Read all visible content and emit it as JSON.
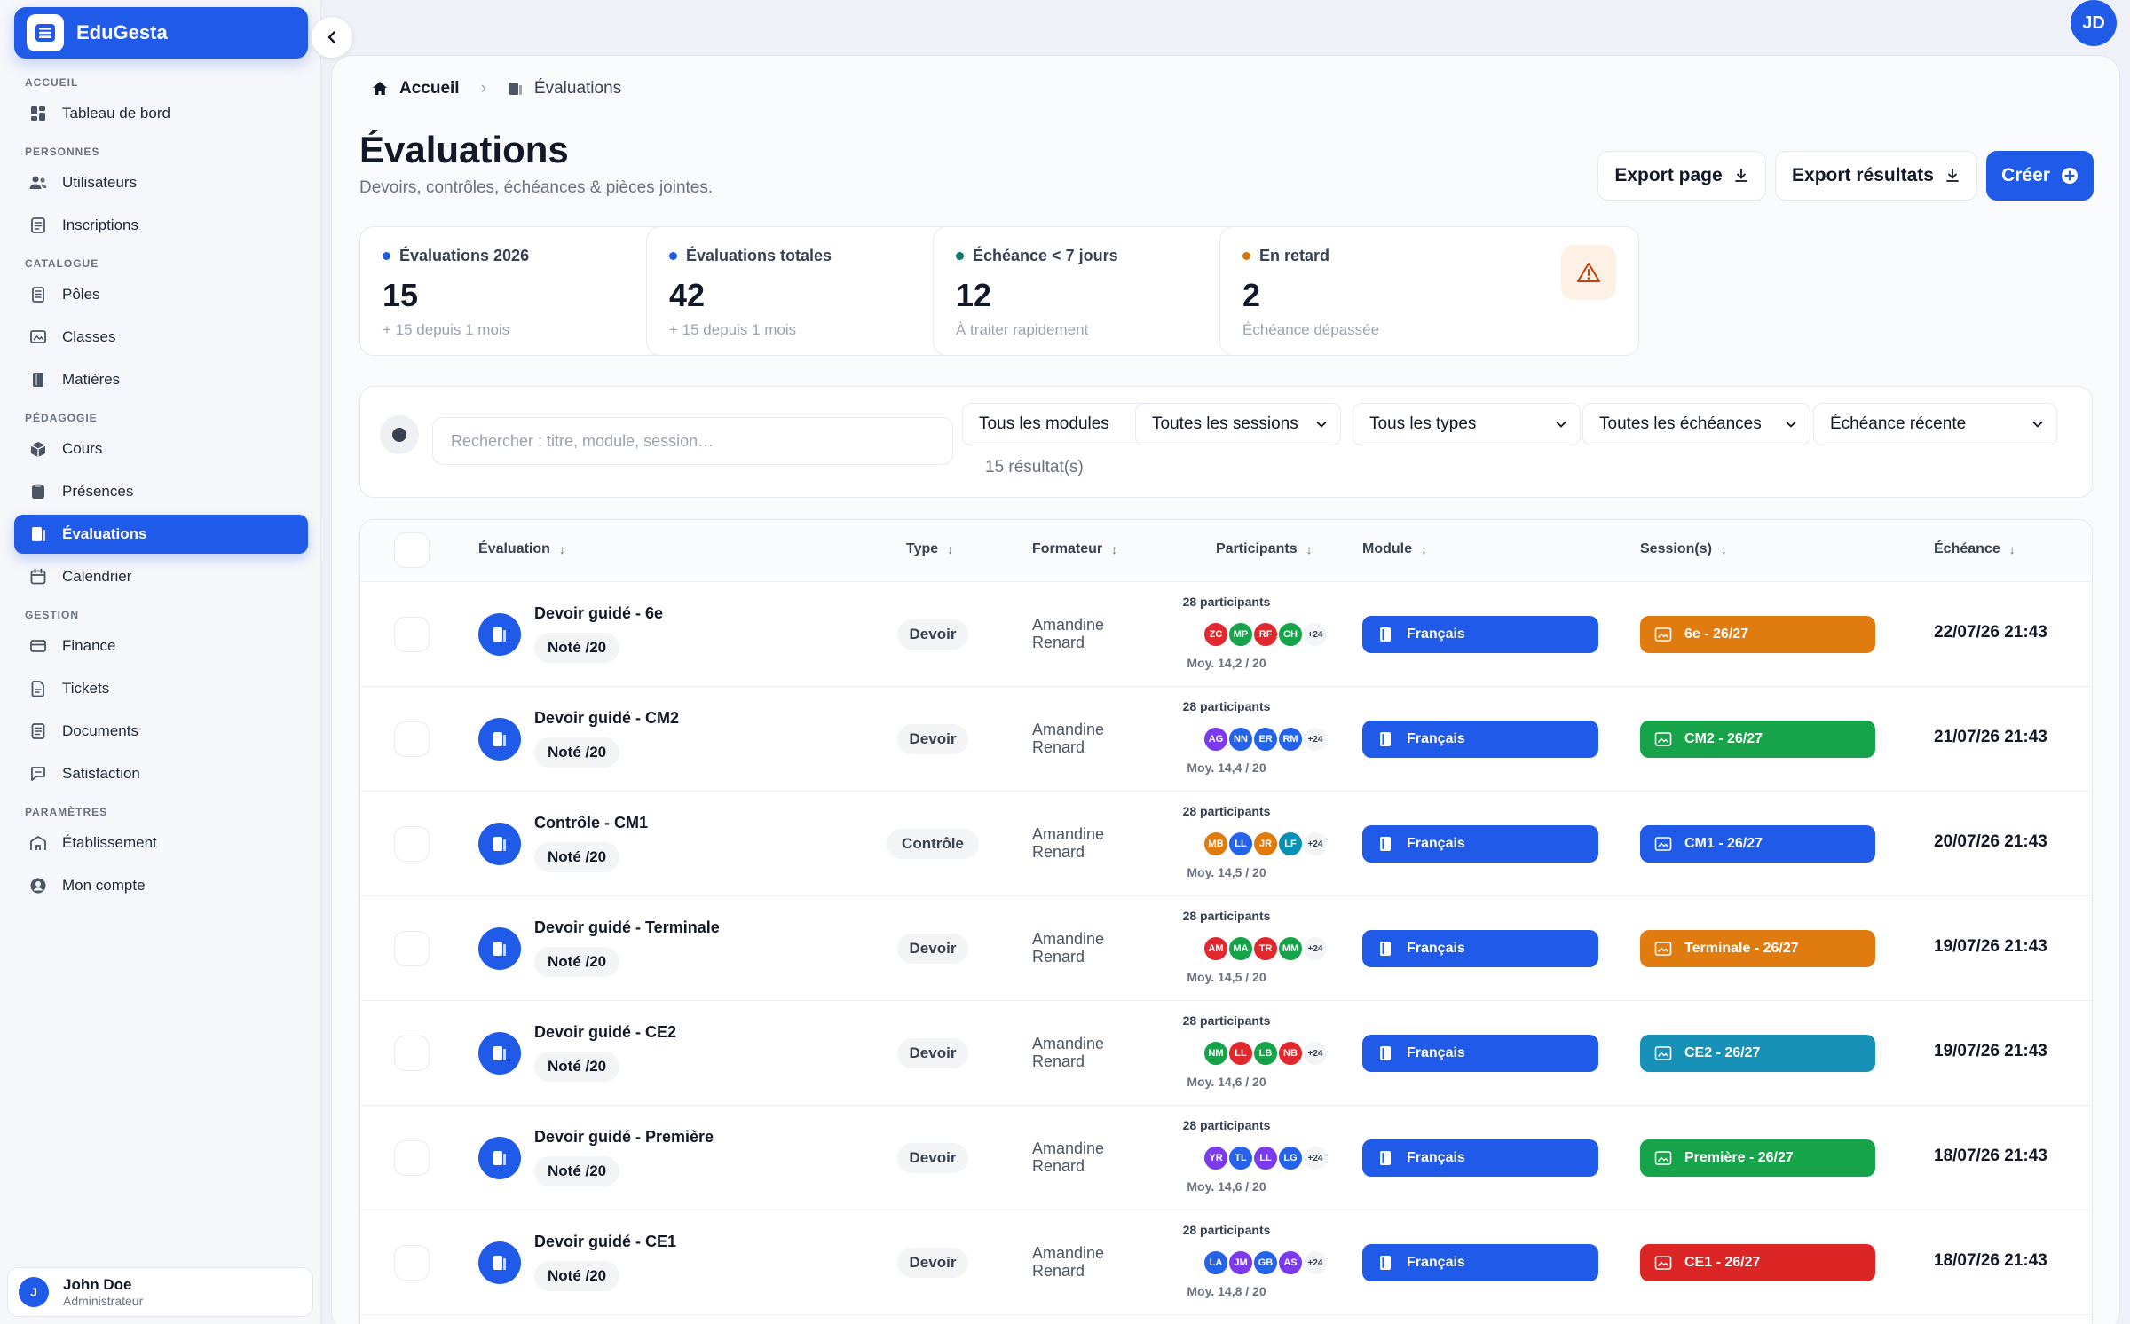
{
  "app": {
    "name": "EduGesta"
  },
  "topbar": {
    "avatar_initials": "JD"
  },
  "sidebar": {
    "sections": [
      {
        "title": "ACCUEIL",
        "items": [
          {
            "label": "Tableau de bord",
            "icon": "dashboard-icon"
          }
        ]
      },
      {
        "title": "PERSONNES",
        "items": [
          {
            "label": "Utilisateurs",
            "icon": "users-icon"
          },
          {
            "label": "Inscriptions",
            "icon": "registrations-icon"
          }
        ]
      },
      {
        "title": "CATALOGUE",
        "items": [
          {
            "label": "Pôles",
            "icon": "poles-icon"
          },
          {
            "label": "Classes",
            "icon": "classes-icon"
          },
          {
            "label": "Matières",
            "icon": "subjects-icon"
          }
        ]
      },
      {
        "title": "PÉDAGOGIE",
        "items": [
          {
            "label": "Cours",
            "icon": "courses-icon"
          },
          {
            "label": "Présences",
            "icon": "attendance-icon"
          },
          {
            "label": "Évaluations",
            "icon": "evaluations-icon",
            "active": true
          },
          {
            "label": "Calendrier",
            "icon": "calendar-icon"
          }
        ]
      },
      {
        "title": "GESTION",
        "items": [
          {
            "label": "Finance",
            "icon": "finance-icon"
          },
          {
            "label": "Tickets",
            "icon": "tickets-icon"
          },
          {
            "label": "Documents",
            "icon": "documents-icon"
          },
          {
            "label": "Satisfaction",
            "icon": "satisfaction-icon"
          }
        ]
      },
      {
        "title": "PARAMÈTRES",
        "items": [
          {
            "label": "Établissement",
            "icon": "school-icon"
          },
          {
            "label": "Mon compte",
            "icon": "account-icon"
          }
        ]
      }
    ],
    "user": {
      "initial": "J",
      "name": "John Doe",
      "role": "Administrateur"
    }
  },
  "breadcrumb": {
    "home": "Accueil",
    "current": "Évaluations"
  },
  "page": {
    "title": "Évaluations",
    "subtitle": "Devoirs, contrôles, échéances & pièces jointes."
  },
  "actions": {
    "export_page": "Export page",
    "export_results": "Export résultats",
    "create": "Créer"
  },
  "stats": [
    {
      "label": "Évaluations 2026",
      "value": "15",
      "note": "+ 15 depuis 1 mois",
      "dot_color": "#1f5ae8",
      "icon": "document-icon",
      "icon_bg": "#e8efff",
      "icon_color": "#1f5ae8"
    },
    {
      "label": "Évaluations totales",
      "value": "42",
      "note": "+ 15 depuis 1 mois",
      "dot_color": "#1f5ae8",
      "icon": "clipboard-icon",
      "icon_bg": "#e8efff",
      "icon_color": "#1f5ae8"
    },
    {
      "label": "Échéance < 7 jours",
      "value": "12",
      "note": "À traiter rapidement",
      "dot_color": "#0f766e",
      "icon": "clock-icon",
      "icon_bg": "#e6f4f1",
      "icon_color": "#0f766e"
    },
    {
      "label": "En retard",
      "value": "2",
      "note": "Échéance dépassée",
      "dot_color": "#d97706",
      "icon": "warning-icon",
      "icon_bg": "#fdf1e6",
      "icon_color": "#c2410c"
    }
  ],
  "filters": {
    "search_placeholder": "Rechercher : titre, module, session…",
    "selects": [
      "Tous les modules",
      "Toutes les sessions",
      "Tous les types",
      "Toutes les échéances",
      "Échéance récente"
    ],
    "result_count": "15 résultat(s)"
  },
  "table": {
    "columns": [
      {
        "label": "Évaluation",
        "sort": "↕"
      },
      {
        "label": "Type",
        "sort": "↕"
      },
      {
        "label": "Formateur",
        "sort": "↕"
      },
      {
        "label": "Participants",
        "sort": "↕"
      },
      {
        "label": "Module",
        "sort": "↕"
      },
      {
        "label": "Session(s)",
        "sort": "↕"
      },
      {
        "label": "Échéance",
        "sort": "↓"
      }
    ],
    "rows": [
      {
        "title": "Devoir guidé - 6e",
        "note": "Noté /20",
        "type": "Devoir",
        "trainer": [
          "Amandine",
          "Renard"
        ],
        "participants": "28 participants",
        "avatars": [
          {
            "i": "ZC",
            "c": "#e0282e"
          },
          {
            "i": "MP",
            "c": "#16a34a"
          },
          {
            "i": "RF",
            "c": "#e0282e"
          },
          {
            "i": "CH",
            "c": "#16a34a"
          }
        ],
        "more": "+24",
        "avg": "Moy. 14,2 / 20",
        "module": "Français",
        "session": "6e - 26/27",
        "session_color": "#e07b0f",
        "due": "22/07/26 21:43"
      },
      {
        "title": "Devoir guidé - CM2",
        "note": "Noté /20",
        "type": "Devoir",
        "trainer": [
          "Amandine",
          "Renard"
        ],
        "participants": "28 participants",
        "avatars": [
          {
            "i": "AG",
            "c": "#7c3aed"
          },
          {
            "i": "NN",
            "c": "#2563eb"
          },
          {
            "i": "ER",
            "c": "#2563eb"
          },
          {
            "i": "RM",
            "c": "#2563eb"
          }
        ],
        "more": "+24",
        "avg": "Moy. 14,4 / 20",
        "module": "Français",
        "session": "CM2 - 26/27",
        "session_color": "#16a34a",
        "due": "21/07/26 21:43"
      },
      {
        "title": "Contrôle - CM1",
        "note": "Noté /20",
        "type": "Contrôle",
        "trainer": [
          "Amandine",
          "Renard"
        ],
        "participants": "28 participants",
        "avatars": [
          {
            "i": "MB",
            "c": "#e07b0f"
          },
          {
            "i": "LL",
            "c": "#2563eb"
          },
          {
            "i": "JR",
            "c": "#e07b0f"
          },
          {
            "i": "LF",
            "c": "#0891b2"
          }
        ],
        "more": "+24",
        "avg": "Moy. 14,5 / 20",
        "module": "Français",
        "session": "CM1 - 26/27",
        "session_color": "#1f5ae8",
        "due": "20/07/26 21:43"
      },
      {
        "title": "Devoir guidé - Terminale",
        "note": "Noté /20",
        "type": "Devoir",
        "trainer": [
          "Amandine",
          "Renard"
        ],
        "participants": "28 participants",
        "avatars": [
          {
            "i": "AM",
            "c": "#e0282e"
          },
          {
            "i": "MA",
            "c": "#16a34a"
          },
          {
            "i": "TR",
            "c": "#e0282e"
          },
          {
            "i": "MM",
            "c": "#16a34a"
          }
        ],
        "more": "+24",
        "avg": "Moy. 14,5 / 20",
        "module": "Français",
        "session": "Terminale - 26/27",
        "session_color": "#e07b0f",
        "due": "19/07/26 21:43"
      },
      {
        "title": "Devoir guidé - CE2",
        "note": "Noté /20",
        "type": "Devoir",
        "trainer": [
          "Amandine",
          "Renard"
        ],
        "participants": "28 participants",
        "avatars": [
          {
            "i": "NM",
            "c": "#16a34a"
          },
          {
            "i": "LL",
            "c": "#e0282e"
          },
          {
            "i": "LB",
            "c": "#16a34a"
          },
          {
            "i": "NB",
            "c": "#e0282e"
          }
        ],
        "more": "+24",
        "avg": "Moy. 14,6 / 20",
        "module": "Français",
        "session": "CE2 - 26/27",
        "session_color": "#1791b8",
        "due": "19/07/26 21:43"
      },
      {
        "title": "Devoir guidé - Première",
        "note": "Noté /20",
        "type": "Devoir",
        "trainer": [
          "Amandine",
          "Renard"
        ],
        "participants": "28 participants",
        "avatars": [
          {
            "i": "YR",
            "c": "#7c3aed"
          },
          {
            "i": "TL",
            "c": "#2563eb"
          },
          {
            "i": "LL",
            "c": "#7c3aed"
          },
          {
            "i": "LG",
            "c": "#2563eb"
          }
        ],
        "more": "+24",
        "avg": "Moy. 14,6 / 20",
        "module": "Français",
        "session": "Première - 26/27",
        "session_color": "#16a34a",
        "due": "18/07/26 21:43"
      },
      {
        "title": "Devoir guidé - CE1",
        "note": "Noté /20",
        "type": "Devoir",
        "trainer": [
          "Amandine",
          "Renard"
        ],
        "participants": "28 participants",
        "avatars": [
          {
            "i": "LA",
            "c": "#2563eb"
          },
          {
            "i": "JM",
            "c": "#7c3aed"
          },
          {
            "i": "GB",
            "c": "#2563eb"
          },
          {
            "i": "AS",
            "c": "#7c3aed"
          }
        ],
        "more": "+24",
        "avg": "Moy. 14,8 / 20",
        "module": "Français",
        "session": "CE1 - 26/27",
        "session_color": "#dc2626",
        "due": "18/07/26 21:43"
      }
    ]
  }
}
